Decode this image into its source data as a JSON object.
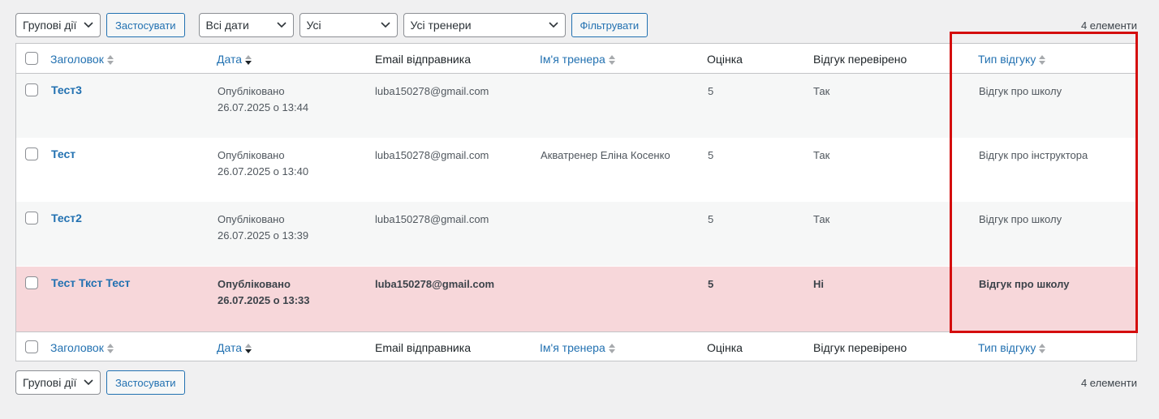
{
  "toolbar": {
    "bulk_actions": "Групові дії",
    "apply": "Застосувати",
    "dates": "Всі дати",
    "all": "Усі",
    "trainers": "Усі тренери",
    "filter": "Фільтрувати",
    "count": "4 елементи"
  },
  "columns": {
    "title": "Заголовок",
    "date": "Дата",
    "email": "Email відправника",
    "trainer": "Ім'я тренера",
    "rating": "Оцінка",
    "verified": "Відгук перевірено",
    "type": "Тип відгуку"
  },
  "rows": [
    {
      "title": "Тест3",
      "status": "Опубліковано",
      "date": "26.07.2025 о 13:44",
      "email": "luba150278@gmail.com",
      "trainer": "",
      "rating": "5",
      "verified": "Так",
      "type": "Відгук про школу"
    },
    {
      "title": "Тест",
      "status": "Опубліковано",
      "date": "26.07.2025 о 13:40",
      "email": "luba150278@gmail.com",
      "trainer": "Акватренер Еліна Косенко",
      "rating": "5",
      "verified": "Так",
      "type": "Відгук про інструктора"
    },
    {
      "title": "Тест2",
      "status": "Опубліковано",
      "date": "26.07.2025 о 13:39",
      "email": "luba150278@gmail.com",
      "trainer": "",
      "rating": "5",
      "verified": "Так",
      "type": "Відгук про школу"
    },
    {
      "title": "Тест Ткст Тест",
      "status": "Опубліковано",
      "date": "26.07.2025 о 13:33",
      "email": "luba150278@gmail.com",
      "trainer": "",
      "rating": "5",
      "verified": "Ні",
      "type": "Відгук про школу"
    }
  ],
  "colors": {
    "link": "#2271b1",
    "pending_row": "#f7d7da",
    "highlight": "#d40d0d"
  },
  "icons": {
    "dropdown": "chevron-down-icon",
    "sortable": "sort-arrows-icon",
    "sorted_desc": "sort-desc-icon"
  }
}
